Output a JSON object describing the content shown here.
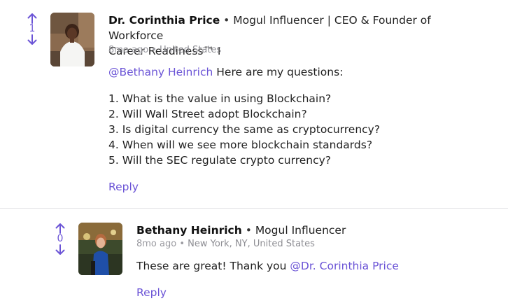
{
  "comment": {
    "votes": "1",
    "author": "Dr. Corinthia Price",
    "separator": "•",
    "title_line1": "Mogul Influencer | CEO & Founder of Workforce",
    "title_line2": "Career Readiness™ I",
    "time": "8mo ago",
    "meta_sep": "•",
    "location": "United States",
    "mention": "@Bethany Heinrich",
    "intro": " Here are my questions:",
    "questions": [
      "1.  What is the value in using Blockchain?",
      "2.  Will Wall Street adopt Blockchain?",
      "3.  Is digital currency the same as cryptocurrency?",
      "4.  When will we see more blockchain standards?",
      "5. Will the SEC regulate crypto currency?"
    ],
    "reply_label": "Reply"
  },
  "reply": {
    "votes": "0",
    "author": "Bethany Heinrich",
    "separator": "•",
    "title": "Mogul Influencer",
    "time": "8mo ago",
    "meta_sep": "•",
    "location": "New York, NY, United States",
    "text": "These are great! Thank you ",
    "mention": "@Dr. Corinthia Price",
    "reply_label": "Reply"
  },
  "colors": {
    "accent": "#6b54d6",
    "meta": "#9a9aa0",
    "divider": "#e3e3e6"
  }
}
